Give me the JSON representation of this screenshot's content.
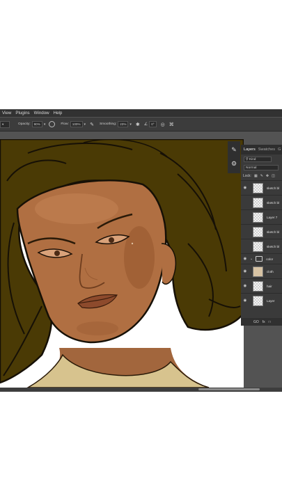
{
  "menubar": {
    "items": [
      "View",
      "Plugins",
      "Window",
      "Help"
    ]
  },
  "options": {
    "opacity_label": "Opacity:",
    "opacity_value": "90%",
    "flow_label": "Flow:",
    "flow_value": "100%",
    "smoothing_label": "Smoothing:",
    "smoothing_value": "23%",
    "angle_value": "0°"
  },
  "layers_panel": {
    "tabs": [
      "Layers",
      "Swatches",
      "G"
    ],
    "filter": "Kind",
    "blend_mode": "Normal",
    "lock_label": "Lock:",
    "layers": [
      {
        "name": "sketch bl",
        "visible": true
      },
      {
        "name": "sketch bl",
        "visible": false
      },
      {
        "name": "Layer 7",
        "visible": false
      },
      {
        "name": "sketch bl",
        "visible": false
      },
      {
        "name": "sketch bl",
        "visible": false
      }
    ],
    "group": {
      "name": "color",
      "visible": true
    },
    "group_layers": [
      {
        "name": "cloth",
        "visible": true
      },
      {
        "name": "hair",
        "visible": true
      },
      {
        "name": "Layer",
        "visible": true
      }
    ],
    "footer": [
      "GO",
      "fx",
      "□"
    ]
  },
  "colors": {
    "hair": "#4a3a05",
    "skin": "#b06f42",
    "ui_dark": "#323232",
    "panel": "#3a3a3a"
  },
  "icons": [
    "brush-pressure-icon",
    "airbrush-icon",
    "settings-gear-icon",
    "angle-icon",
    "symmetry-icon"
  ]
}
